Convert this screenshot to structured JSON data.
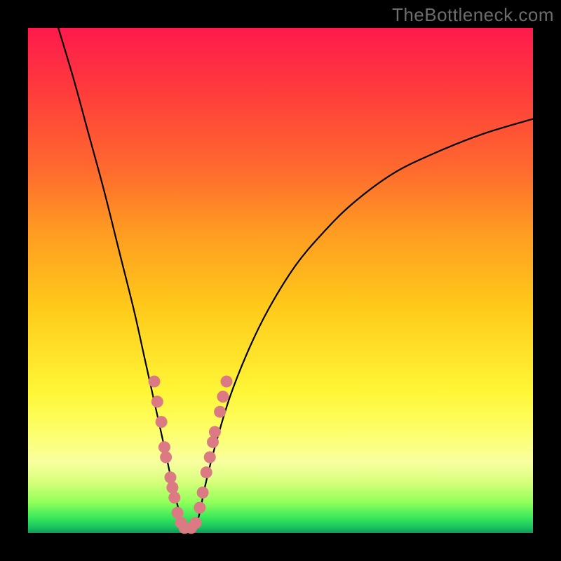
{
  "watermark": "TheBottleneck.com",
  "colors": {
    "marker": "#dc7a83",
    "curve": "#000000",
    "frame": "#000000"
  },
  "chart_data": {
    "type": "line",
    "title": "",
    "xlabel": "",
    "ylabel": "",
    "xlim": [
      0,
      100
    ],
    "ylim": [
      0,
      100
    ],
    "note": "Axes have no visible tick labels; x and y are normalized 0–100. y represents bottleneck score (0 = best/green at bottom, 100 = worst/red at top).",
    "series": [
      {
        "name": "bottleneck-curve",
        "x": [
          6,
          9,
          12,
          15,
          18,
          21,
          23,
          25,
          27,
          28.5,
          30,
          31,
          32,
          33,
          34,
          35,
          37,
          40,
          44,
          48,
          53,
          58,
          64,
          72,
          80,
          90,
          100
        ],
        "y": [
          100,
          90,
          79,
          68,
          56,
          44,
          35,
          26,
          17,
          10,
          4,
          1,
          0,
          1,
          4,
          9,
          17,
          27,
          37,
          45,
          53,
          59,
          65,
          71,
          75,
          79,
          82
        ]
      }
    ],
    "markers": {
      "name": "highlighted-points",
      "points": [
        {
          "x": 25.0,
          "y": 30
        },
        {
          "x": 25.6,
          "y": 26
        },
        {
          "x": 26.4,
          "y": 22
        },
        {
          "x": 27.0,
          "y": 17
        },
        {
          "x": 27.3,
          "y": 15
        },
        {
          "x": 28.2,
          "y": 11
        },
        {
          "x": 28.6,
          "y": 9
        },
        {
          "x": 29.0,
          "y": 7
        },
        {
          "x": 29.6,
          "y": 4
        },
        {
          "x": 30.3,
          "y": 2
        },
        {
          "x": 31.0,
          "y": 1
        },
        {
          "x": 32.3,
          "y": 1
        },
        {
          "x": 33.2,
          "y": 2
        },
        {
          "x": 34.0,
          "y": 5
        },
        {
          "x": 34.6,
          "y": 8
        },
        {
          "x": 35.3,
          "y": 12
        },
        {
          "x": 36.0,
          "y": 15
        },
        {
          "x": 36.6,
          "y": 18
        },
        {
          "x": 37.0,
          "y": 20
        },
        {
          "x": 38.0,
          "y": 24
        },
        {
          "x": 38.6,
          "y": 27
        },
        {
          "x": 39.3,
          "y": 30
        }
      ]
    }
  }
}
